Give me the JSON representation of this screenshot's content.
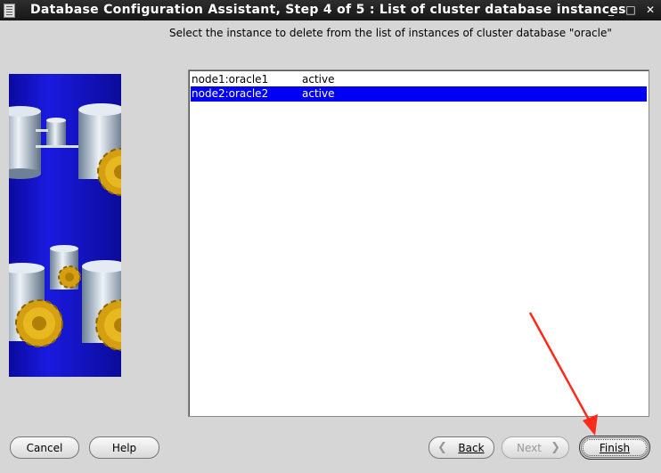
{
  "window": {
    "title": "Database Configuration Assistant, Step 4 of 5 : List of cluster database instances",
    "controls": [
      "_",
      "□",
      "✕"
    ]
  },
  "instruction": "Select the instance to delete from the list of instances of cluster database \"oracle\"",
  "instances": [
    {
      "name": "node1:oracle1",
      "status": "active",
      "selected": false
    },
    {
      "name": "node2:oracle2",
      "status": "active",
      "selected": true
    }
  ],
  "buttons": {
    "cancel": "Cancel",
    "help": "Help",
    "back": "Back",
    "next": "Next",
    "finish": "Finish"
  },
  "colors": {
    "selection": "#0000f5",
    "annotation_arrow": "#ff2a1a"
  }
}
